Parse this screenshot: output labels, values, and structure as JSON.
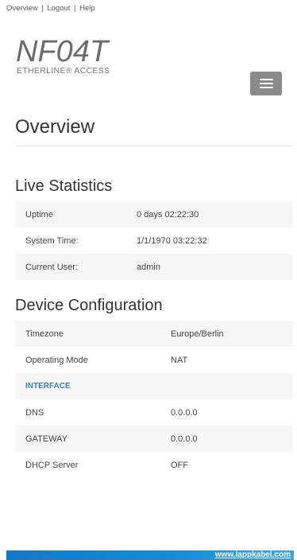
{
  "nav": {
    "links": [
      "Overview",
      "Logout",
      "Help"
    ],
    "separator": "|"
  },
  "logo": {
    "main": "NF04T",
    "sub": "ETHERLINE® ACCESS"
  },
  "menu": {
    "icon": "hamburger-menu-icon"
  },
  "page": {
    "title": "Overview"
  },
  "live_stats": {
    "title": "Live Statistics",
    "rows": [
      {
        "label": "Uptime",
        "value": "0 days 02:22:30"
      },
      {
        "label": "System Time:",
        "value": "1/1/1970 03:22:32"
      },
      {
        "label": "Current User:",
        "value": "admin"
      }
    ]
  },
  "device_config": {
    "title": "Device Configuration",
    "rows": [
      {
        "label": "Timezone",
        "value": "Europe/Berlin"
      },
      {
        "label": "Operating Mode",
        "value": "NAT"
      },
      {
        "label": "INTERFACE",
        "value": ""
      },
      {
        "label": "DNS",
        "value": "0.0.0.0"
      },
      {
        "label": "GATEWAY",
        "value": "0.0.0.0"
      },
      {
        "label": "DHCP Server",
        "value": "OFF"
      }
    ]
  },
  "footer": {
    "url": "www.lappkabel.com"
  },
  "colors": {
    "accent_blue": "#1a8bd6",
    "interface_header": "#3a7fb8",
    "menu_button": "#8a8a8a"
  }
}
